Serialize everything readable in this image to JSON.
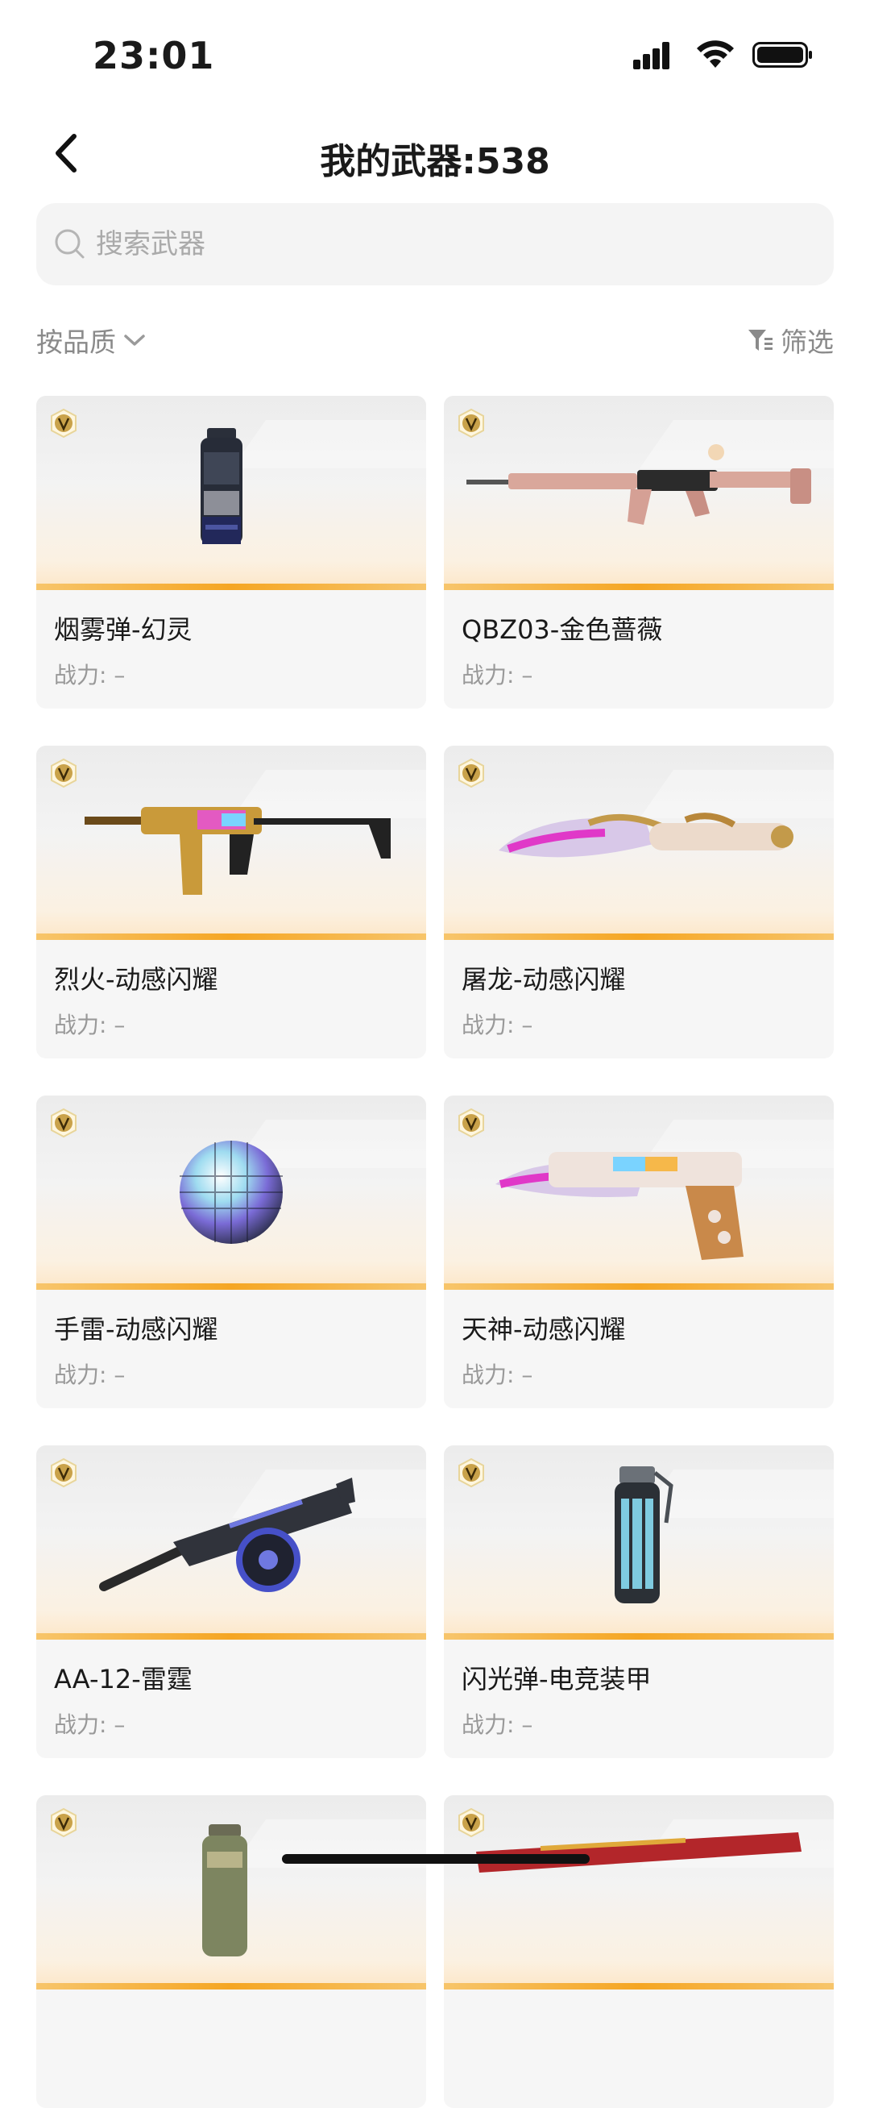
{
  "status": {
    "time": "23:01"
  },
  "header": {
    "title": "我的武器:538"
  },
  "search": {
    "placeholder": "搜索武器"
  },
  "filters": {
    "sort_label": "按品质",
    "filter_label": "筛选"
  },
  "weapons": [
    {
      "name": "烟雾弹-幻灵",
      "power_label": "战力: –"
    },
    {
      "name": "QBZ03-金色蔷薇",
      "power_label": "战力: –"
    },
    {
      "name": "烈火-动感闪耀",
      "power_label": "战力: –"
    },
    {
      "name": "屠龙-动感闪耀",
      "power_label": "战力: –"
    },
    {
      "name": "手雷-动感闪耀",
      "power_label": "战力: –"
    },
    {
      "name": "天神-动感闪耀",
      "power_label": "战力: –"
    },
    {
      "name": "AA-12-雷霆",
      "power_label": "战力: –"
    },
    {
      "name": "闪光弹-电竞装甲",
      "power_label": "战力: –"
    },
    {
      "name": "",
      "power_label": ""
    },
    {
      "name": "",
      "power_label": ""
    }
  ],
  "colors": {
    "accent_bar": "#f5a623",
    "card_bg": "#f6f6f6",
    "search_bg": "#f4f4f4",
    "vip_badge": "#c9a24a"
  }
}
